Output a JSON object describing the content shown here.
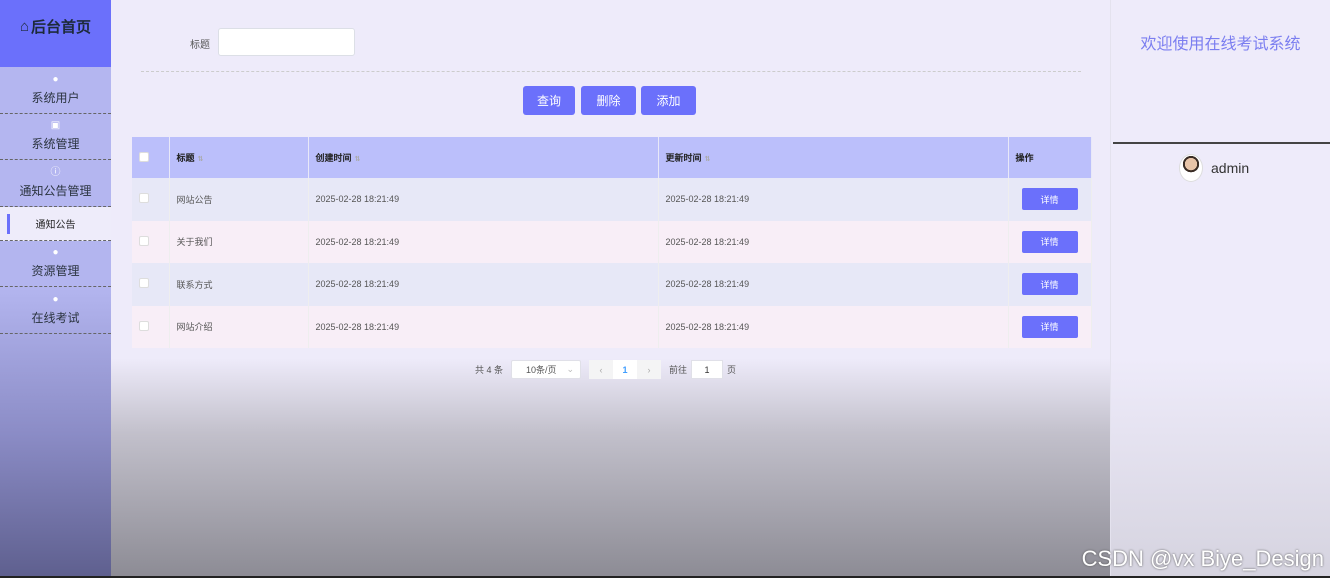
{
  "sidebar": {
    "logo": "后台首页",
    "items": [
      {
        "label": "系统用户",
        "icon": "user-icon"
      },
      {
        "label": "系统管理",
        "icon": "image-icon"
      },
      {
        "label": "通知公告管理",
        "icon": "info-icon"
      },
      {
        "label": "通知公告",
        "active": true
      },
      {
        "label": "资源管理",
        "icon": "bulb-icon"
      },
      {
        "label": "在线考试",
        "icon": "bulb-icon"
      }
    ]
  },
  "search": {
    "label": "标题",
    "value": "",
    "buttons": {
      "query": "查询",
      "delete": "删除",
      "add": "添加"
    }
  },
  "table": {
    "headers": [
      "标题",
      "创建时间",
      "更新时间",
      "操作"
    ],
    "rows": [
      {
        "title": "网站公告",
        "created": "2025-02-28 18:21:49",
        "updated": "2025-02-28 18:21:49",
        "action": "详情"
      },
      {
        "title": "关于我们",
        "created": "2025-02-28 18:21:49",
        "updated": "2025-02-28 18:21:49",
        "action": "详情"
      },
      {
        "title": "联系方式",
        "created": "2025-02-28 18:21:49",
        "updated": "2025-02-28 18:21:49",
        "action": "详情"
      },
      {
        "title": "网站介绍",
        "created": "2025-02-28 18:21:49",
        "updated": "2025-02-28 18:21:49",
        "action": "详情"
      }
    ]
  },
  "pagination": {
    "total": "共 4 条",
    "page_size": "10条/页",
    "current": "1",
    "goto_label": "前往",
    "goto_value": "1",
    "page_suffix": "页"
  },
  "right": {
    "welcome": "欢迎使用在线考试系统",
    "username": "admin"
  },
  "watermark": "CSDN @vx Biye_Design",
  "colors": {
    "accent": "#6b70fb",
    "header": "#bbbffb"
  }
}
